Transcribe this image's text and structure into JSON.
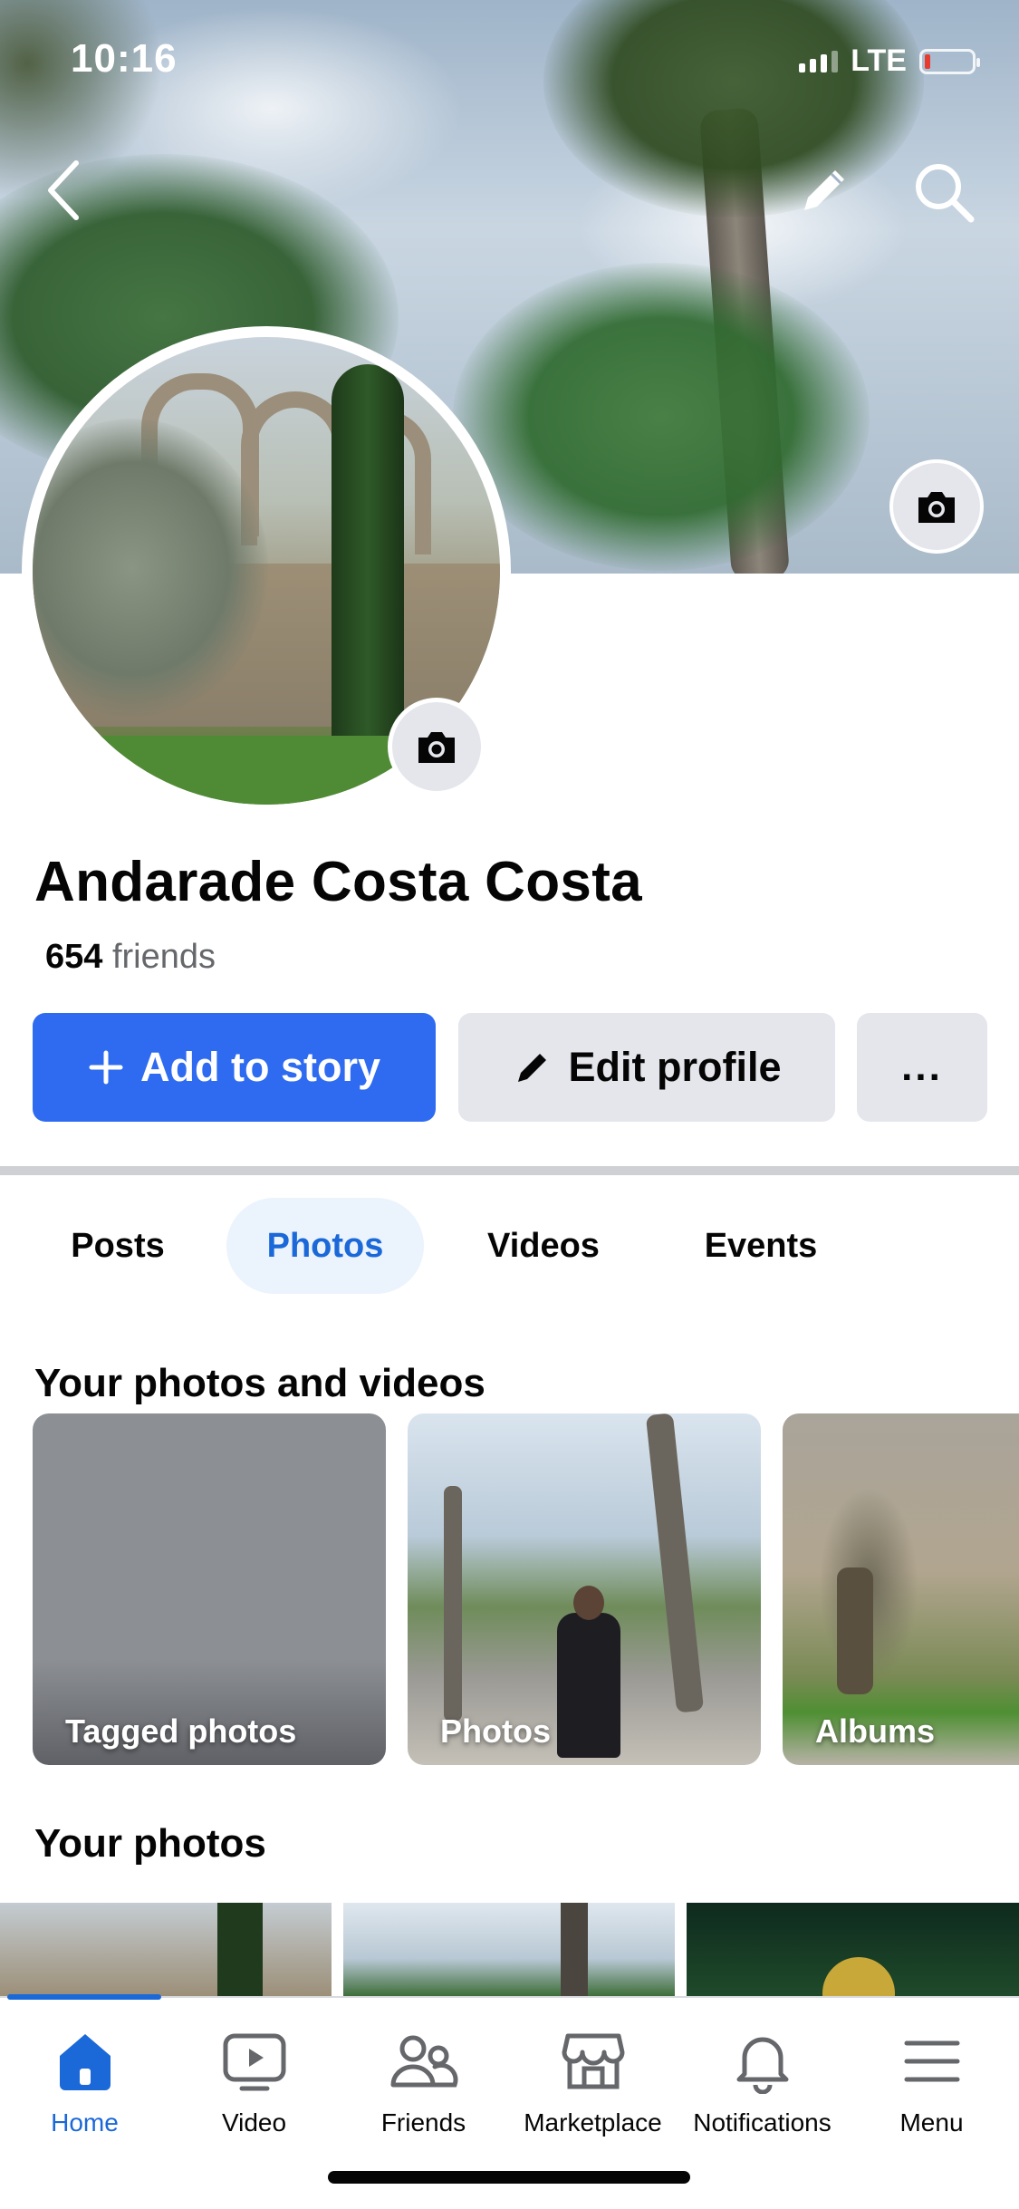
{
  "status_bar": {
    "time": "10:16",
    "network": "LTE"
  },
  "cover": {
    "icons": [
      "back-icon",
      "pencil-icon",
      "search-icon",
      "camera-icon"
    ]
  },
  "profile": {
    "name": "Andarade Costa Costa",
    "friends_count": "654",
    "friends_label": " friends"
  },
  "actions": {
    "add_story": "Add to story",
    "edit_profile": "Edit profile",
    "more": "..."
  },
  "tabs": [
    {
      "label": "Posts",
      "active": false
    },
    {
      "label": "Photos",
      "active": true
    },
    {
      "label": "Videos",
      "active": false
    },
    {
      "label": "Events",
      "active": false
    }
  ],
  "photos_section": {
    "title": "Your photos and videos",
    "tiles": [
      "Tagged photos",
      "Photos",
      "Albums"
    ]
  },
  "your_photos": {
    "title": "Your photos"
  },
  "bottom_nav": [
    {
      "label": "Home",
      "icon": "home-icon",
      "active": true
    },
    {
      "label": "Video",
      "icon": "video-icon",
      "active": false
    },
    {
      "label": "Friends",
      "icon": "friends-icon",
      "active": false
    },
    {
      "label": "Marketplace",
      "icon": "marketplace-icon",
      "active": false
    },
    {
      "label": "Notifications",
      "icon": "bell-icon",
      "active": false
    },
    {
      "label": "Menu",
      "icon": "menu-icon",
      "active": false
    }
  ],
  "colors": {
    "accent": "#2e6bf0",
    "active_tab_text": "#1b68d8",
    "active_tab_bg": "#ebf3fd",
    "button_gray": "#e4e6eb"
  }
}
